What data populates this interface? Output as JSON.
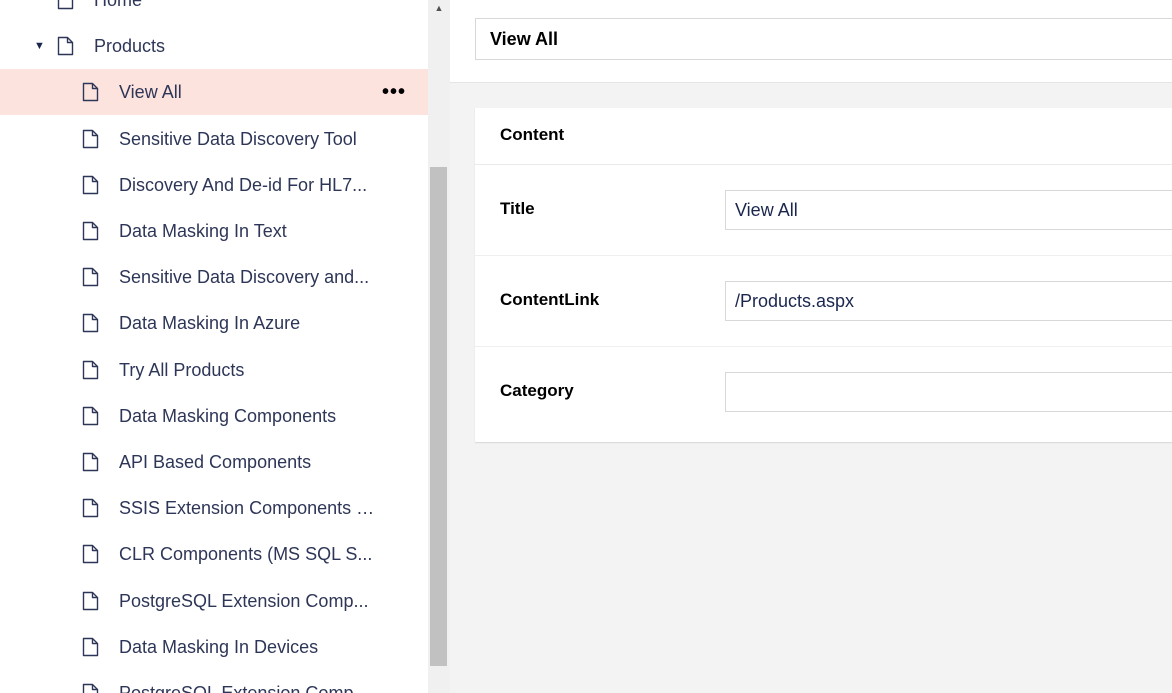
{
  "tree": {
    "items": [
      {
        "label": "Home",
        "level": 0,
        "expandable": false,
        "active": false
      },
      {
        "label": "Products",
        "level": 0,
        "expandable": true,
        "active": false
      },
      {
        "label": "View All",
        "level": 1,
        "expandable": false,
        "active": true
      },
      {
        "label": "Sensitive Data Discovery Tool",
        "level": 1,
        "expandable": false,
        "active": false
      },
      {
        "label": "Discovery And De-id For HL7...",
        "level": 1,
        "expandable": false,
        "active": false
      },
      {
        "label": "Data Masking In Text",
        "level": 1,
        "expandable": false,
        "active": false
      },
      {
        "label": "Sensitive Data Discovery and...",
        "level": 1,
        "expandable": false,
        "active": false
      },
      {
        "label": "Data Masking In Azure",
        "level": 1,
        "expandable": false,
        "active": false
      },
      {
        "label": "Try All Products",
        "level": 1,
        "expandable": false,
        "active": false
      },
      {
        "label": "Data Masking Components",
        "level": 1,
        "expandable": false,
        "active": false
      },
      {
        "label": "API Based Components",
        "level": 1,
        "expandable": false,
        "active": false
      },
      {
        "label": "SSIS Extension Components (...",
        "level": 1,
        "expandable": false,
        "active": false
      },
      {
        "label": "CLR Components (MS SQL S...",
        "level": 1,
        "expandable": false,
        "active": false
      },
      {
        "label": "PostgreSQL Extension Comp...",
        "level": 1,
        "expandable": false,
        "active": false
      },
      {
        "label": "Data Masking In Devices",
        "level": 1,
        "expandable": false,
        "active": false
      },
      {
        "label": "PostgreSQL Extension Comp...",
        "level": 1,
        "expandable": false,
        "active": false
      }
    ],
    "more_actions_label": "•••",
    "icon_name": "document-icon"
  },
  "editor": {
    "name_value": "View All",
    "group_title": "Content",
    "properties": [
      {
        "label": "Title",
        "value": "View All"
      },
      {
        "label": "ContentLink",
        "value": "/Products.aspx"
      },
      {
        "label": "Category",
        "value": ""
      }
    ]
  },
  "scrollbar": {
    "up_arrow": "▲"
  },
  "colors": {
    "active_row_bg": "#fde3de",
    "text": "#2e3658",
    "panel_bg": "#f4f3f3"
  }
}
